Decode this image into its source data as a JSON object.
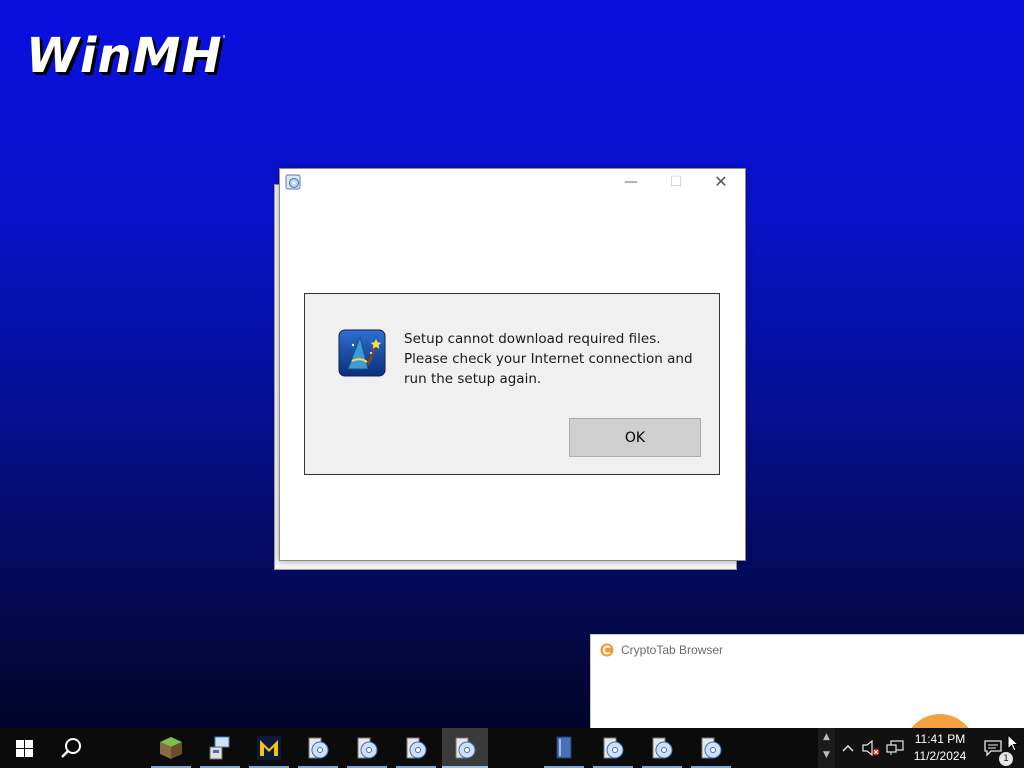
{
  "desktop": {
    "logo_text": "WinMH",
    "logo_mark": "'"
  },
  "window": {
    "icon": "setup-app-icon",
    "minimize_label": "—",
    "maximize_label": "☐",
    "close_label": "✕"
  },
  "dialog": {
    "icon": "wizard-icon",
    "message_lines": [
      "Setup cannot download required files.",
      "Please check your Internet connection and",
      "run the setup again."
    ],
    "ok_label": "OK"
  },
  "notification": {
    "icon": "cryptotab-icon",
    "title": "CryptoTab Browser"
  },
  "taskbar": {
    "items": [
      {
        "name": "minecraft-icon",
        "running": true
      },
      {
        "name": "network-setup-icon",
        "running": true
      },
      {
        "name": "m-app-icon",
        "running": true
      },
      {
        "name": "setup-disc-icon-1",
        "running": true
      },
      {
        "name": "setup-disc-icon-2",
        "running": true
      },
      {
        "name": "setup-disc-icon-3",
        "running": true
      },
      {
        "name": "setup-disc-icon-4",
        "running": true,
        "active": true
      },
      {
        "name": "book-icon",
        "running": true
      },
      {
        "name": "setup-disc-icon-5",
        "running": true
      },
      {
        "name": "setup-disc-icon-6",
        "running": true
      },
      {
        "name": "setup-disc-icon-7",
        "running": true
      }
    ],
    "clock": {
      "time": "11:41 PM",
      "date": "11/2/2024"
    },
    "notification_count": "1"
  },
  "colors": {
    "desktop_top": "#0a10e0",
    "desktop_bottom": "#010318",
    "taskbar": "#0b0b0b",
    "accent": "#f2a040"
  }
}
